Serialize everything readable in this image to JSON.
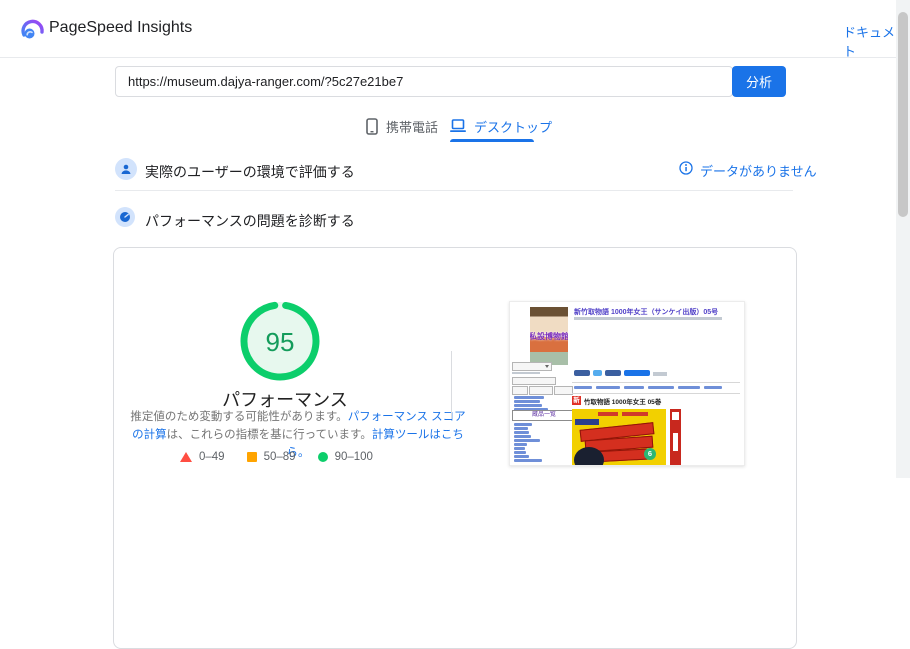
{
  "header": {
    "title": "PageSpeed Insights",
    "doc_link": "ドキュメント"
  },
  "analyze": {
    "url_value": "https://museum.dajya-ranger.com/?5c27e21be7",
    "button_label": "分析"
  },
  "tabs": {
    "mobile_label": "携帯電話",
    "desktop_label": "デスクトップ"
  },
  "sections": {
    "field_title": "実際のユーザーの環境で評価する",
    "field_no_data": "データがありません",
    "lab_title": "パフォーマンスの問題を診断する"
  },
  "performance": {
    "score": "95",
    "label": "パフォーマンス",
    "desc_part1": "推定値のため変動する可能性があります。",
    "desc_link1": "パフォーマンス スコアの計算",
    "desc_part2": "は、これらの指標を基に行っています。",
    "desc_link2": "計算ツールはこちら。",
    "legend": [
      {
        "shape": "triangle",
        "color": "#ff4e42",
        "range": "0–49"
      },
      {
        "shape": "square",
        "color": "#ffa400",
        "range": "50–89"
      },
      {
        "shape": "circle",
        "color": "#0cce6b",
        "range": "90–100"
      }
    ],
    "ring_color": "#0cce6b",
    "score_color": "#149c5b"
  },
  "thumbnail": {
    "site_logo_text": "私設博物館",
    "page_title": "新竹取物語 1000年女王（サンケイ出版）05号",
    "sidebar_box_label": "蔵品一覧",
    "article_badge": "新",
    "article_heading": "竹取物語 1000年女王 05巻",
    "cover_badge": "6"
  },
  "colors": {
    "accent_blue": "#1a73e8",
    "text_dark": "#202124",
    "text_gray": "#5f6368",
    "border_gray": "#dadce0"
  }
}
